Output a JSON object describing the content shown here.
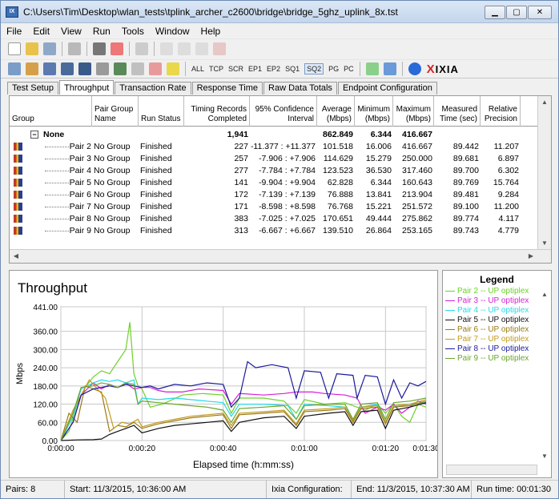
{
  "window": {
    "title": "C:\\Users\\Tim\\Desktop\\wlan_tests\\tplink_archer_c2600\\bridge\\bridge_5ghz_uplink_8x.tst"
  },
  "menu": [
    "File",
    "Edit",
    "View",
    "Run",
    "Tools",
    "Window",
    "Help"
  ],
  "toolbar2_labels": [
    "ALL",
    "TCP",
    "SCR",
    "EP1",
    "EP2",
    "SQ1",
    "SQ2",
    "PG",
    "PC"
  ],
  "brand": {
    "x": "X",
    "name": "IXIA"
  },
  "tabs": [
    "Test Setup",
    "Throughput",
    "Transaction Rate",
    "Response Time",
    "Raw Data Totals",
    "Endpoint Configuration"
  ],
  "active_tab": "Throughput",
  "table": {
    "headers": [
      "Group",
      "Pair Group\nName",
      "Run Status",
      "Timing Records\nCompleted",
      "95% Confidence\nInterval",
      "Average\n(Mbps)",
      "Minimum\n(Mbps)",
      "Maximum\n(Mbps)",
      "Measured\nTime (sec)",
      "Relative\nPrecision"
    ],
    "group_row": {
      "expander": "−",
      "group": "None",
      "records": "1,941",
      "average": "862.849",
      "minimum": "6.344",
      "maximum": "416.667"
    },
    "rows": [
      {
        "pair": "Pair 2",
        "name": "No Group",
        "status": "Finished",
        "records": "227",
        "ci": "-11.377 : +11.377",
        "avg": "101.518",
        "min": "16.006",
        "max": "416.667",
        "time": "89.442",
        "prec": "11.207"
      },
      {
        "pair": "Pair 3",
        "name": "No Group",
        "status": "Finished",
        "records": "257",
        "ci": "-7.906 : +7.906",
        "avg": "114.629",
        "min": "15.279",
        "max": "250.000",
        "time": "89.681",
        "prec": "6.897"
      },
      {
        "pair": "Pair 4",
        "name": "No Group",
        "status": "Finished",
        "records": "277",
        "ci": "-7.784 : +7.784",
        "avg": "123.523",
        "min": "36.530",
        "max": "317.460",
        "time": "89.700",
        "prec": "6.302"
      },
      {
        "pair": "Pair 5",
        "name": "No Group",
        "status": "Finished",
        "records": "141",
        "ci": "-9.904 : +9.904",
        "avg": "62.828",
        "min": "6.344",
        "max": "160.643",
        "time": "89.769",
        "prec": "15.764"
      },
      {
        "pair": "Pair 6",
        "name": "No Group",
        "status": "Finished",
        "records": "172",
        "ci": "-7.139 : +7.139",
        "avg": "76.888",
        "min": "13.841",
        "max": "213.904",
        "time": "89.481",
        "prec": "9.284"
      },
      {
        "pair": "Pair 7",
        "name": "No Group",
        "status": "Finished",
        "records": "171",
        "ci": "-8.598 : +8.598",
        "avg": "76.768",
        "min": "15.221",
        "max": "251.572",
        "time": "89.100",
        "prec": "11.200"
      },
      {
        "pair": "Pair 8",
        "name": "No Group",
        "status": "Finished",
        "records": "383",
        "ci": "-7.025 : +7.025",
        "avg": "170.651",
        "min": "49.444",
        "max": "275.862",
        "time": "89.774",
        "prec": "4.117"
      },
      {
        "pair": "Pair 9",
        "name": "No Group",
        "status": "Finished",
        "records": "313",
        "ci": "-6.667 : +6.667",
        "avg": "139.510",
        "min": "26.864",
        "max": "253.165",
        "time": "89.743",
        "prec": "4.779"
      }
    ]
  },
  "chart_data": {
    "type": "line",
    "title": "Throughput",
    "xlabel": "Elapsed time (h:mm:ss)",
    "ylabel": "Mbps",
    "xlim": [
      0,
      90
    ],
    "ylim": [
      0,
      441
    ],
    "yticks": [
      0,
      60,
      120,
      180,
      240,
      300,
      360,
      441
    ],
    "ytick_labels": [
      "0.00",
      "60.00",
      "120.00",
      "180.00",
      "240.00",
      "300.00",
      "360.00",
      "441.00"
    ],
    "xticks": [
      0,
      20,
      40,
      60,
      80,
      90
    ],
    "xtick_labels": [
      "0:00:00",
      "0:00:20",
      "0:00:40",
      "0:01:00",
      "0:01:20",
      "0:01:30"
    ],
    "grid": true,
    "series": [
      {
        "name": "Pair 2 -- UP optiplex",
        "color": "#6dd12a",
        "points": [
          [
            0,
            0
          ],
          [
            2,
            30
          ],
          [
            4,
            120
          ],
          [
            6,
            175
          ],
          [
            8,
            210
          ],
          [
            10,
            230
          ],
          [
            12,
            220
          ],
          [
            14,
            260
          ],
          [
            16,
            300
          ],
          [
            17,
            390
          ],
          [
            18,
            220
          ],
          [
            19,
            180
          ],
          [
            20,
            170
          ],
          [
            22,
            110
          ],
          [
            25,
            120
          ],
          [
            30,
            150
          ],
          [
            35,
            155
          ],
          [
            40,
            150
          ],
          [
            42,
            90
          ],
          [
            44,
            140
          ],
          [
            50,
            140
          ],
          [
            55,
            130
          ],
          [
            58,
            90
          ],
          [
            60,
            135
          ],
          [
            65,
            120
          ],
          [
            70,
            125
          ],
          [
            75,
            100
          ],
          [
            78,
            120
          ],
          [
            80,
            90
          ],
          [
            82,
            120
          ],
          [
            84,
            80
          ],
          [
            86,
            60
          ],
          [
            88,
            120
          ],
          [
            90,
            110
          ]
        ]
      },
      {
        "name": "Pair 3 -- UP optiplex",
        "color": "#d61fd6",
        "points": [
          [
            0,
            0
          ],
          [
            3,
            60
          ],
          [
            5,
            150
          ],
          [
            8,
            190
          ],
          [
            10,
            170
          ],
          [
            12,
            185
          ],
          [
            14,
            175
          ],
          [
            16,
            190
          ],
          [
            18,
            170
          ],
          [
            20,
            175
          ],
          [
            22,
            175
          ],
          [
            24,
            165
          ],
          [
            26,
            160
          ],
          [
            30,
            160
          ],
          [
            34,
            170
          ],
          [
            40,
            165
          ],
          [
            42,
            120
          ],
          [
            44,
            155
          ],
          [
            50,
            150
          ],
          [
            55,
            155
          ],
          [
            58,
            160
          ],
          [
            62,
            160
          ],
          [
            65,
            155
          ],
          [
            70,
            150
          ],
          [
            73,
            140
          ],
          [
            75,
            90
          ],
          [
            78,
            110
          ],
          [
            80,
            100
          ],
          [
            82,
            120
          ],
          [
            84,
            90
          ],
          [
            86,
            110
          ],
          [
            88,
            130
          ],
          [
            90,
            120
          ]
        ]
      },
      {
        "name": "Pair 4 -- UP optiplex",
        "color": "#26d8e8",
        "points": [
          [
            0,
            0
          ],
          [
            3,
            80
          ],
          [
            5,
            170
          ],
          [
            8,
            190
          ],
          [
            10,
            200
          ],
          [
            12,
            195
          ],
          [
            14,
            200
          ],
          [
            16,
            190
          ],
          [
            18,
            200
          ],
          [
            19,
            120
          ],
          [
            20,
            140
          ],
          [
            24,
            135
          ],
          [
            28,
            140
          ],
          [
            32,
            135
          ],
          [
            36,
            130
          ],
          [
            40,
            125
          ],
          [
            42,
            80
          ],
          [
            44,
            120
          ],
          [
            50,
            120
          ],
          [
            56,
            115
          ],
          [
            58,
            70
          ],
          [
            60,
            120
          ],
          [
            66,
            115
          ],
          [
            70,
            110
          ],
          [
            72,
            70
          ],
          [
            74,
            110
          ],
          [
            78,
            120
          ],
          [
            80,
            60
          ],
          [
            82,
            110
          ],
          [
            86,
            120
          ],
          [
            90,
            125
          ]
        ]
      },
      {
        "name": "Pair 5 -- UP optiplex",
        "color": "#111111",
        "points": [
          [
            0,
            0
          ],
          [
            4,
            2
          ],
          [
            8,
            3
          ],
          [
            10,
            5
          ],
          [
            12,
            20
          ],
          [
            14,
            30
          ],
          [
            16,
            40
          ],
          [
            18,
            50
          ],
          [
            20,
            25
          ],
          [
            24,
            40
          ],
          [
            28,
            50
          ],
          [
            32,
            55
          ],
          [
            36,
            60
          ],
          [
            40,
            65
          ],
          [
            42,
            30
          ],
          [
            44,
            60
          ],
          [
            50,
            75
          ],
          [
            55,
            80
          ],
          [
            58,
            40
          ],
          [
            60,
            80
          ],
          [
            66,
            90
          ],
          [
            70,
            95
          ],
          [
            72,
            50
          ],
          [
            74,
            95
          ],
          [
            78,
            100
          ],
          [
            80,
            40
          ],
          [
            82,
            100
          ],
          [
            86,
            110
          ],
          [
            90,
            125
          ]
        ]
      },
      {
        "name": "Pair 6 -- UP optiplex",
        "color": "#9a7a14",
        "points": [
          [
            0,
            0
          ],
          [
            2,
            90
          ],
          [
            4,
            60
          ],
          [
            6,
            180
          ],
          [
            8,
            170
          ],
          [
            10,
            160
          ],
          [
            12,
            30
          ],
          [
            14,
            50
          ],
          [
            16,
            45
          ],
          [
            18,
            60
          ],
          [
            20,
            40
          ],
          [
            24,
            55
          ],
          [
            28,
            65
          ],
          [
            32,
            75
          ],
          [
            36,
            80
          ],
          [
            40,
            85
          ],
          [
            42,
            40
          ],
          [
            44,
            85
          ],
          [
            50,
            90
          ],
          [
            55,
            95
          ],
          [
            58,
            50
          ],
          [
            60,
            95
          ],
          [
            66,
            100
          ],
          [
            70,
            105
          ],
          [
            72,
            60
          ],
          [
            74,
            105
          ],
          [
            78,
            110
          ],
          [
            80,
            55
          ],
          [
            82,
            110
          ],
          [
            86,
            115
          ],
          [
            90,
            130
          ]
        ]
      },
      {
        "name": "Pair 7 -- UP optiplex",
        "color": "#c49a1e",
        "points": [
          [
            0,
            0
          ],
          [
            3,
            100
          ],
          [
            5,
            150
          ],
          [
            7,
            200
          ],
          [
            9,
            170
          ],
          [
            11,
            140
          ],
          [
            13,
            40
          ],
          [
            15,
            60
          ],
          [
            17,
            55
          ],
          [
            19,
            70
          ],
          [
            20,
            45
          ],
          [
            24,
            60
          ],
          [
            28,
            70
          ],
          [
            32,
            80
          ],
          [
            36,
            85
          ],
          [
            40,
            90
          ],
          [
            42,
            50
          ],
          [
            44,
            90
          ],
          [
            50,
            95
          ],
          [
            55,
            100
          ],
          [
            58,
            55
          ],
          [
            60,
            100
          ],
          [
            66,
            105
          ],
          [
            70,
            110
          ],
          [
            72,
            65
          ],
          [
            74,
            110
          ],
          [
            78,
            115
          ],
          [
            80,
            60
          ],
          [
            82,
            115
          ],
          [
            86,
            120
          ],
          [
            90,
            135
          ]
        ]
      },
      {
        "name": "Pair 8 -- UP optiplex",
        "color": "#1a1a9a",
        "points": [
          [
            0,
            0
          ],
          [
            3,
            60
          ],
          [
            5,
            150
          ],
          [
            8,
            170
          ],
          [
            10,
            175
          ],
          [
            12,
            180
          ],
          [
            14,
            175
          ],
          [
            16,
            185
          ],
          [
            18,
            180
          ],
          [
            20,
            175
          ],
          [
            22,
            180
          ],
          [
            24,
            170
          ],
          [
            28,
            185
          ],
          [
            32,
            180
          ],
          [
            36,
            190
          ],
          [
            40,
            185
          ],
          [
            42,
            110
          ],
          [
            44,
            140
          ],
          [
            46,
            260
          ],
          [
            48,
            240
          ],
          [
            52,
            250
          ],
          [
            56,
            240
          ],
          [
            58,
            140
          ],
          [
            60,
            230
          ],
          [
            64,
            225
          ],
          [
            66,
            140
          ],
          [
            68,
            220
          ],
          [
            72,
            215
          ],
          [
            73,
            140
          ],
          [
            75,
            215
          ],
          [
            78,
            210
          ],
          [
            80,
            120
          ],
          [
            82,
            200
          ],
          [
            84,
            140
          ],
          [
            86,
            190
          ],
          [
            88,
            180
          ],
          [
            90,
            195
          ]
        ]
      },
      {
        "name": "Pair 9 -- UP optiplex",
        "color": "#6aa52a",
        "points": [
          [
            0,
            0
          ],
          [
            3,
            90
          ],
          [
            5,
            175
          ],
          [
            8,
            180
          ],
          [
            10,
            190
          ],
          [
            12,
            185
          ],
          [
            14,
            175
          ],
          [
            16,
            190
          ],
          [
            18,
            185
          ],
          [
            19,
            120
          ],
          [
            20,
            130
          ],
          [
            24,
            125
          ],
          [
            28,
            120
          ],
          [
            32,
            115
          ],
          [
            36,
            110
          ],
          [
            40,
            100
          ],
          [
            42,
            60
          ],
          [
            44,
            105
          ],
          [
            50,
            110
          ],
          [
            55,
            115
          ],
          [
            58,
            70
          ],
          [
            60,
            115
          ],
          [
            66,
            120
          ],
          [
            70,
            120
          ],
          [
            72,
            70
          ],
          [
            74,
            120
          ],
          [
            78,
            125
          ],
          [
            80,
            70
          ],
          [
            82,
            125
          ],
          [
            86,
            130
          ],
          [
            90,
            140
          ]
        ]
      }
    ]
  },
  "legend": {
    "title": "Legend"
  },
  "status": {
    "pairs": "Pairs: 8",
    "start": "Start: 11/3/2015, 10:36:00 AM",
    "ixia_conf": "Ixia Configuration:",
    "end": "End: 11/3/2015, 10:37:30 AM",
    "runtime": "Run time: 00:01:30"
  }
}
